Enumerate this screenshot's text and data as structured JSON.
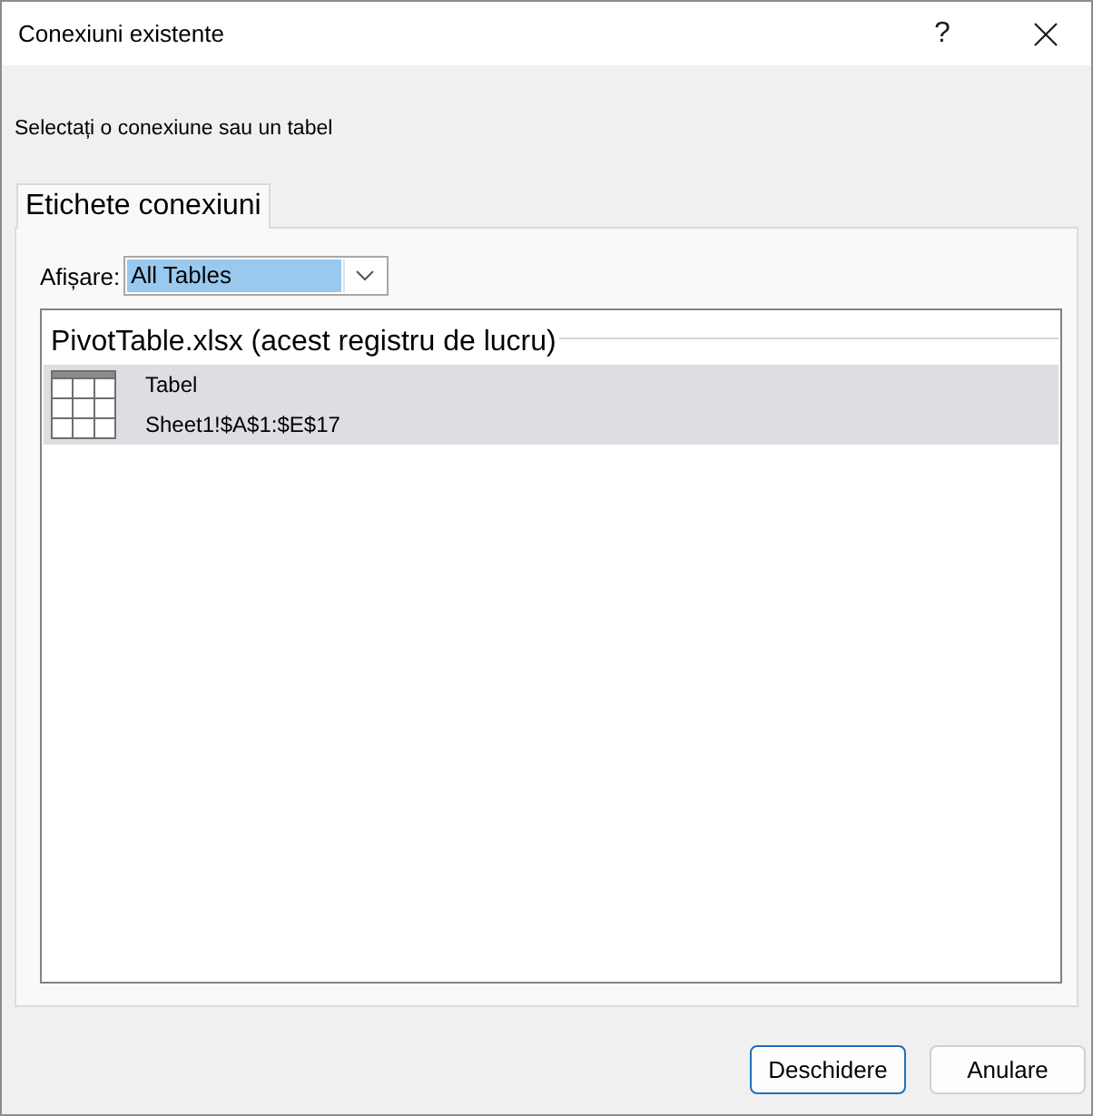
{
  "window": {
    "title": "Conexiuni existente",
    "help_button": "?"
  },
  "instruction": "Selectați o conexiune sau un tabel",
  "tabs": [
    {
      "label": "Etichete conexiuni",
      "selected": true
    }
  ],
  "show_filter": {
    "label": "Afișare:",
    "value": "All Tables"
  },
  "connection_list": {
    "groups": [
      {
        "title": "PivotTable.xlsx (acest registru de lucru)",
        "items": [
          {
            "kind": "table",
            "name": "Tabel",
            "range": "Sheet1!$A$1:$E$17",
            "selected": true
          }
        ]
      }
    ]
  },
  "buttons": [
    {
      "label": "Deschidere",
      "default": true
    },
    {
      "label": "Anulare",
      "default": false
    }
  ]
}
